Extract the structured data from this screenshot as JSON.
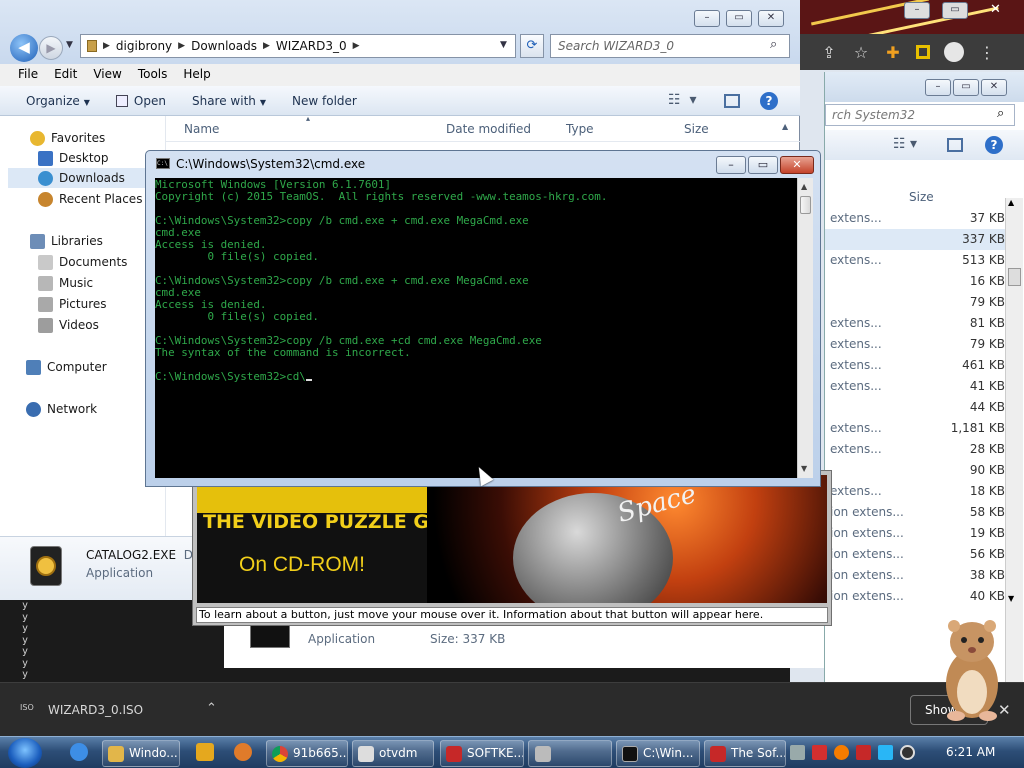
{
  "chrome": {
    "tray": {
      "icons": [
        "share-icon",
        "star-icon",
        "puzzle-icon",
        "reading-icon",
        "profile-icon",
        "menu-icon"
      ]
    }
  },
  "explorer_back": {
    "search_placeholder": "rch System32",
    "size_header": "Size",
    "rows": [
      {
        "type": "extens...",
        "size": "37 KB"
      },
      {
        "type": "",
        "size": "337 KB"
      },
      {
        "type": "extens...",
        "size": "513 KB"
      },
      {
        "type": "",
        "size": "16 KB"
      },
      {
        "type": "",
        "size": "79 KB"
      },
      {
        "type": "extens...",
        "size": "81 KB"
      },
      {
        "type": "extens...",
        "size": "79 KB"
      },
      {
        "type": "extens...",
        "size": "461 KB"
      },
      {
        "type": "extens...",
        "size": "41 KB"
      },
      {
        "type": "",
        "size": "44 KB"
      },
      {
        "type": "extens...",
        "size": "1,181 KB"
      },
      {
        "type": "extens...",
        "size": "28 KB"
      },
      {
        "type": "",
        "size": "90 KB"
      },
      {
        "type": "extens...",
        "size": "18 KB"
      },
      {
        "type": "ion extens...",
        "size": "58 KB"
      },
      {
        "type": "ion extens...",
        "size": "19 KB"
      },
      {
        "type": "ion extens...",
        "size": "56 KB"
      },
      {
        "type": "ion extens...",
        "size": "38 KB"
      },
      {
        "type": "ion extens...",
        "size": "40 KB"
      }
    ],
    "status": {
      "type": "Application",
      "size": "Size: 337 KB"
    }
  },
  "explorer": {
    "breadcrumb": [
      "digibrony",
      "Downloads",
      "WIZARD3_0"
    ],
    "search_placeholder": "Search WIZARD3_0",
    "menu": [
      "File",
      "Edit",
      "View",
      "Tools",
      "Help"
    ],
    "commands": {
      "organize": "Organize",
      "open": "Open",
      "share": "Share with",
      "new_folder": "New folder"
    },
    "columns": {
      "name": "Name",
      "date": "Date modified",
      "type": "Type",
      "size": "Size"
    },
    "nav": {
      "favorites": "Favorites",
      "desktop": "Desktop",
      "downloads": "Downloads",
      "recent": "Recent Places",
      "libraries": "Libraries",
      "documents": "Documents",
      "music": "Music",
      "pictures": "Pictures",
      "videos": "Videos",
      "computer": "Computer",
      "network": "Network"
    },
    "details": {
      "name": "CATALOG2.EXE",
      "name_suffix": "Da",
      "type": "Application"
    }
  },
  "cmd": {
    "title": "C:\\Windows\\System32\\cmd.exe",
    "lines": [
      "Microsoft Windows [Version 6.1.7601]",
      "Copyright (c) 2015 TeamOS.  All rights reserved -www.teamos-hkrg.com.",
      "",
      "C:\\Windows\\System32>copy /b cmd.exe + cmd.exe MegaCmd.exe",
      "cmd.exe",
      "Access is denied.",
      "        0 file(s) copied.",
      "",
      "C:\\Windows\\System32>copy /b cmd.exe + cmd.exe MegaCmd.exe",
      "cmd.exe",
      "Access is denied.",
      "        0 file(s) copied.",
      "",
      "C:\\Windows\\System32>copy /b cmd.exe +cd cmd.exe MegaCmd.exe",
      "The syntax of the command is incorrect.",
      "",
      "C:\\Windows\\System32>cd\\"
    ]
  },
  "game": {
    "title": "THE VIDEO PUZZLE GAME",
    "subtitle": "On CD-ROM!",
    "art_word": "Space",
    "status": "To learn about a button, just move your mouse over it. Information about that button will appear here."
  },
  "console_strip": "y\ny\ny\ny\ny\ny\ny",
  "shelf": {
    "file": "WIZARD3_0.ISO",
    "show_all": "Show"
  },
  "taskbar": {
    "items": [
      "Windo...",
      "91b665...",
      "otvdm",
      "SOFTKE...",
      "C:\\Win...",
      "The Sof..."
    ],
    "clock": "6:21 AM"
  },
  "colors": {
    "console_text": "#2fa84a",
    "taskbar": "#2d4e77",
    "explorer_header": "#c9d9ee"
  }
}
